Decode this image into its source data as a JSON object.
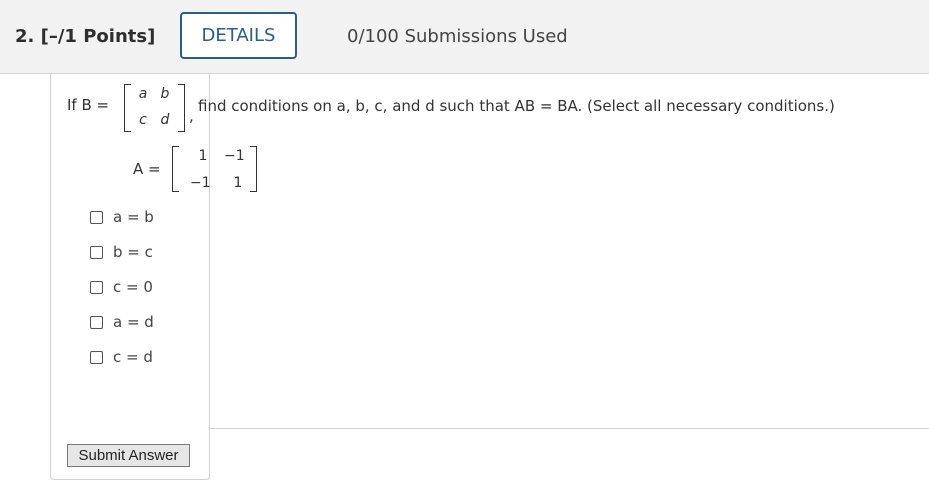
{
  "header": {
    "question_number": "2.  [–/1 Points]",
    "details_label": "DETAILS",
    "submissions": "0/100 Submissions Used"
  },
  "question": {
    "if_text": "If B =",
    "matrix_b": [
      "a",
      "b",
      "c",
      "d"
    ],
    "comma": ",",
    "prompt": "find conditions on a, b, c, and d such that AB = BA. (Select all necessary conditions.)",
    "a_label": "A =",
    "matrix_a": [
      "1",
      "−1",
      "−1",
      "1"
    ]
  },
  "options": [
    {
      "label": "a = b",
      "checked": false
    },
    {
      "label": "b = c",
      "checked": false
    },
    {
      "label": "c = 0",
      "checked": false
    },
    {
      "label": "a = d",
      "checked": false
    },
    {
      "label": "c = d",
      "checked": false
    }
  ],
  "submit_label": "Submit Answer"
}
